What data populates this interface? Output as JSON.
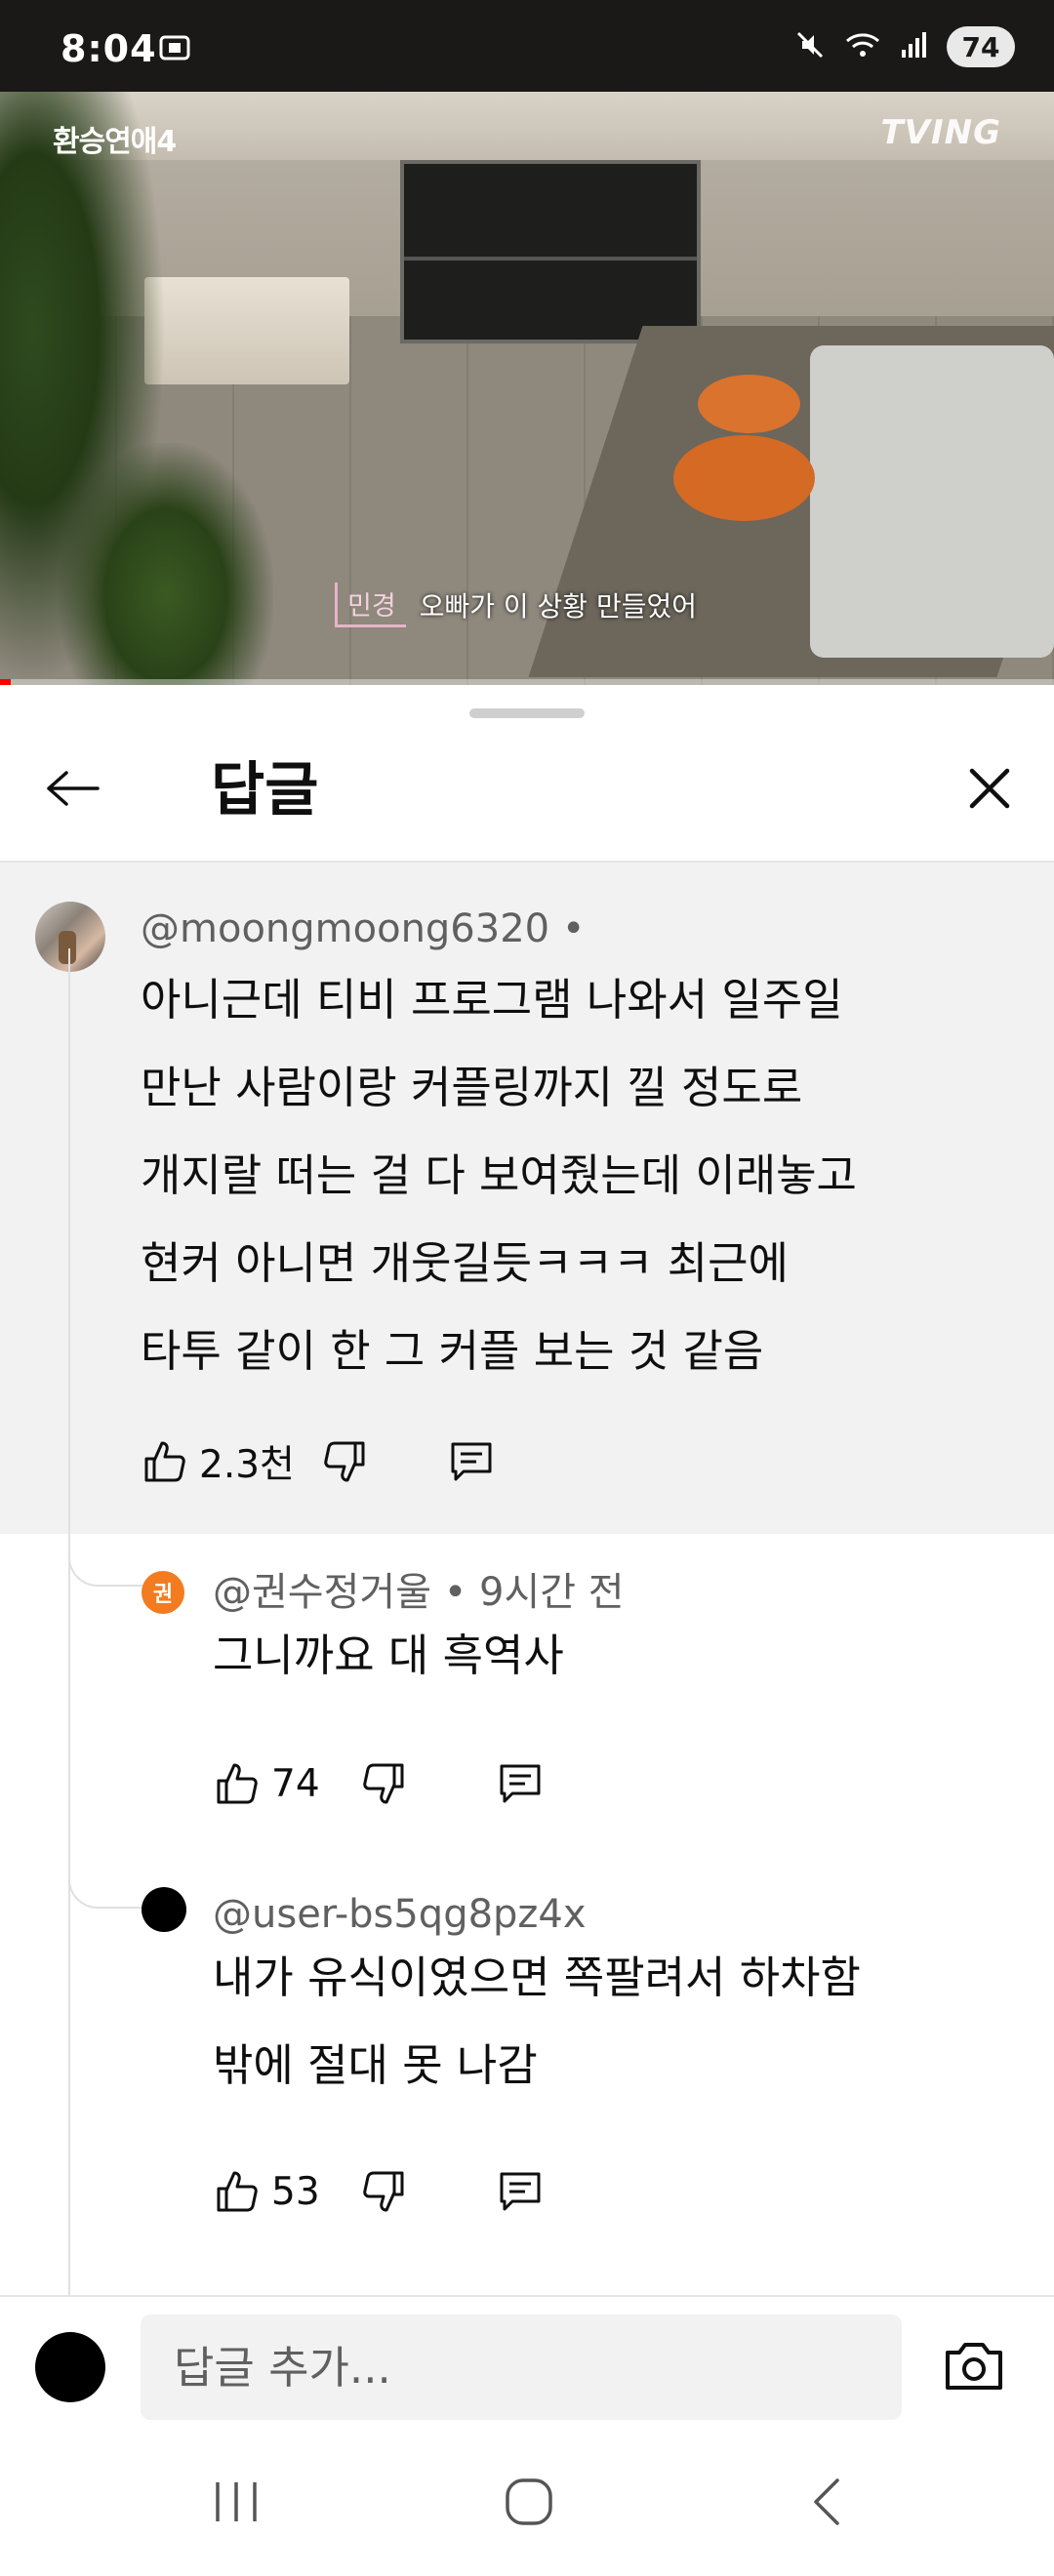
{
  "status_bar": {
    "time": "8:04",
    "battery": "74",
    "icons": [
      "screen-record-icon",
      "mute-icon",
      "wifi-icon",
      "signal-icon",
      "battery-icon"
    ]
  },
  "video": {
    "show_logo": "환승연애4",
    "brand": "TVING",
    "caption_speaker": "민경",
    "caption_text": "오빠가 이 상황 만들었어",
    "progress_fraction": 0.01,
    "progress_color": "#ff0000"
  },
  "sheet": {
    "title": "답글",
    "back_icon": "arrow-left-icon",
    "close_icon": "close-icon"
  },
  "parent_comment": {
    "handle": "@moongmoong6320 •",
    "lines": [
      "아니근데 티비 프로그램 나와서 일주일",
      "만난 사람이랑 커플링까지 낄 정도로",
      "개지랄 떠는 걸 다 보여줬는데 이래놓고",
      "현커 아니면 개웃길듯ㅋㅋㅋ 최근에",
      "타투 같이 한 그 커플 보는 것 같음"
    ],
    "likes": "2.3천"
  },
  "replies": [
    {
      "avatar_letter": "권",
      "handle": "@권수정거울 • 9시간 전",
      "lines": [
        "그니까요 대 흑역사"
      ],
      "likes": "74"
    },
    {
      "avatar_letter": "",
      "handle": "@user-bs5qg8pz4x",
      "lines": [
        "내가 유식이였으면 쪽팔려서 하차함",
        "밖에 절대 못 나감"
      ],
      "likes": "53"
    }
  ],
  "input": {
    "placeholder": "답글 추가..."
  },
  "colors": {
    "accent_avatar": "#f27c1f",
    "highlight_bg": "#f2f2f2"
  }
}
